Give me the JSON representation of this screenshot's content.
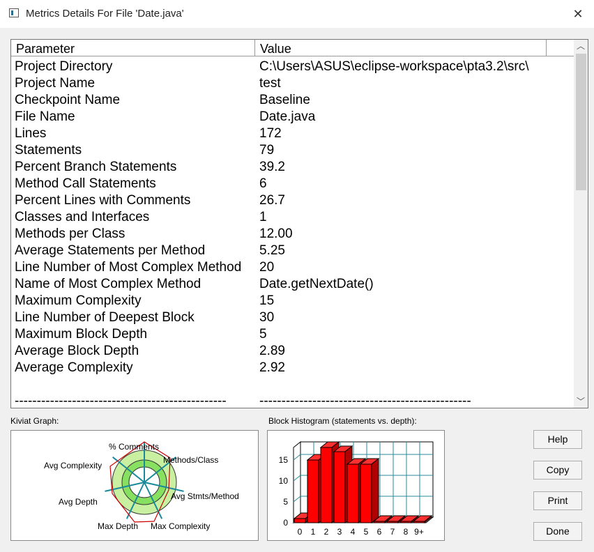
{
  "window": {
    "title": "Metrics Details For File 'Date.java'",
    "close_symbol": "✕"
  },
  "table": {
    "headers": [
      "Parameter",
      "Value"
    ],
    "rows": [
      [
        "Project Directory",
        "C:\\Users\\ASUS\\eclipse-workspace\\pta3.2\\src\\"
      ],
      [
        "Project Name",
        "test"
      ],
      [
        "Checkpoint Name",
        "Baseline"
      ],
      [
        "File Name",
        "Date.java"
      ],
      [
        "Lines",
        "172"
      ],
      [
        "Statements",
        "79"
      ],
      [
        "Percent Branch Statements",
        "39.2"
      ],
      [
        "Method Call Statements",
        "6"
      ],
      [
        "Percent Lines with Comments",
        "26.7"
      ],
      [
        "Classes and Interfaces",
        "1"
      ],
      [
        "Methods per Class",
        "12.00"
      ],
      [
        "Average Statements per Method",
        "5.25"
      ],
      [
        "Line Number of Most Complex Method",
        "20"
      ],
      [
        "Name of Most Complex Method",
        "Date.getNextDate()"
      ],
      [
        "Maximum Complexity",
        "15"
      ],
      [
        "Line Number of Deepest Block",
        "30"
      ],
      [
        "Maximum Block Depth",
        "5"
      ],
      [
        "Average Block Depth",
        "2.89"
      ],
      [
        "Average Complexity",
        "2.92"
      ],
      [
        "",
        ""
      ],
      [
        "------------------------------------------------",
        "------------------------------------------------"
      ]
    ]
  },
  "kiviat": {
    "label": "Kiviat Graph:",
    "axes": [
      "% Comments",
      "Methods/Class",
      "Avg Stmts/Method",
      "Max Complexity",
      "Max Depth",
      "Avg Depth",
      "Avg Complexity"
    ]
  },
  "histogram": {
    "label": "Block Histogram (statements vs. depth):",
    "categories": [
      "0",
      "1",
      "2",
      "3",
      "4",
      "5",
      "6",
      "7",
      "8",
      "9+"
    ],
    "values": [
      1,
      15,
      18,
      17,
      14,
      14,
      0,
      0,
      0,
      0
    ],
    "y_ticks": [
      "0",
      "5",
      "10",
      "15"
    ],
    "ylim": [
      0,
      18
    ],
    "bar_color": "#ff0000"
  },
  "buttons": {
    "help": "Help",
    "copy": "Copy",
    "print": "Print",
    "done": "Done"
  }
}
